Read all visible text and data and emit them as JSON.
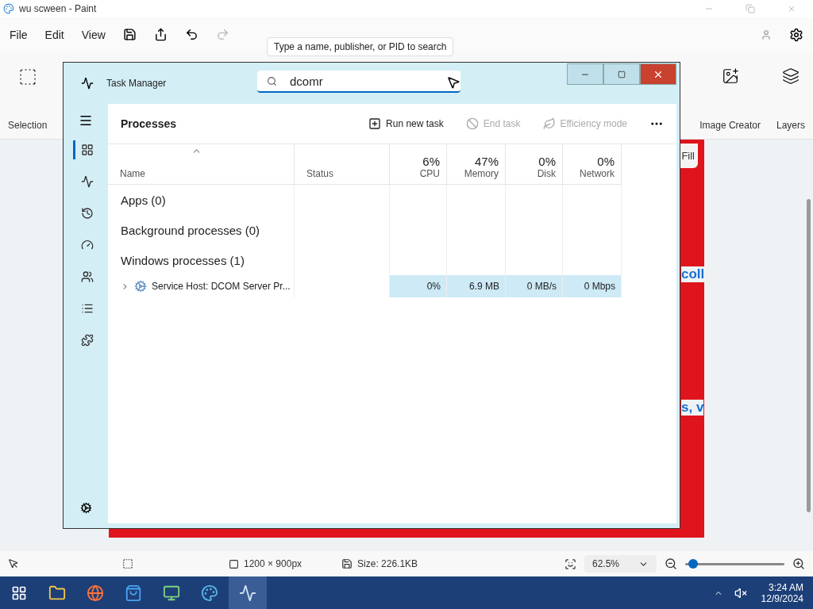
{
  "paint": {
    "title": "wu scween - Paint",
    "menu": [
      "File",
      "Edit",
      "View"
    ],
    "tools": [
      {
        "label": "Selection",
        "kind": "selection"
      },
      {
        "label": "Image Creator",
        "kind": "creator"
      },
      {
        "label": "Layers",
        "kind": "layers"
      }
    ],
    "canvas_texts": [
      {
        "text": "Fill",
        "kind": "button"
      },
      {
        "text": "coll",
        "kind": "fragment"
      },
      {
        "text": "s, v",
        "kind": "fragment"
      }
    ],
    "status": {
      "dimensions": "1200 × 900px",
      "size": "Size: 226.1KB",
      "zoom": "62.5%",
      "zoom_level": {
        "level": 0.08
      }
    }
  },
  "tooltip": "Type a name, publisher, or PID to search",
  "task_manager": {
    "title": "Task Manager",
    "search": {
      "value": "dcomr"
    },
    "nav": [
      {
        "kind": "processes",
        "selected": true
      },
      {
        "kind": "performance",
        "selected": false
      },
      {
        "kind": "history",
        "selected": false
      },
      {
        "kind": "startup",
        "selected": false
      },
      {
        "kind": "users",
        "selected": false
      },
      {
        "kind": "details",
        "selected": false
      },
      {
        "kind": "services",
        "selected": false
      }
    ],
    "heading": "Processes",
    "actions": [
      {
        "label": "Run new task",
        "kind": "run",
        "disabled": false
      },
      {
        "label": "End task",
        "kind": "end",
        "disabled": true
      },
      {
        "label": "Efficiency mode",
        "kind": "efficiency",
        "disabled": true
      }
    ],
    "columns": [
      {
        "name": "Name"
      },
      {
        "name": "Status"
      },
      {
        "percent": "6%",
        "name": "CPU"
      },
      {
        "percent": "47%",
        "name": "Memory"
      },
      {
        "percent": "0%",
        "name": "Disk"
      },
      {
        "percent": "0%",
        "name": "Network"
      }
    ],
    "groups": [
      {
        "label": "Apps (0)"
      },
      {
        "label": "Background processes (0)"
      },
      {
        "label": "Windows processes (1)"
      }
    ],
    "rows": [
      {
        "name": "Service Host: DCOM Server Pr...",
        "expanded": false,
        "cpu": "0%",
        "memory": "6.9 MB",
        "disk": "0 MB/s",
        "network": "0 Mbps"
      }
    ]
  },
  "taskbar": {
    "apps": [
      {
        "kind": "explorer",
        "selected": false
      },
      {
        "kind": "firefox",
        "selected": false
      },
      {
        "kind": "store",
        "selected": false
      },
      {
        "kind": "monitor",
        "selected": false
      },
      {
        "kind": "paint",
        "selected": false
      },
      {
        "kind": "taskmanager",
        "selected": true
      }
    ],
    "time": "3:24 AM",
    "date": "12/9/2024"
  }
}
